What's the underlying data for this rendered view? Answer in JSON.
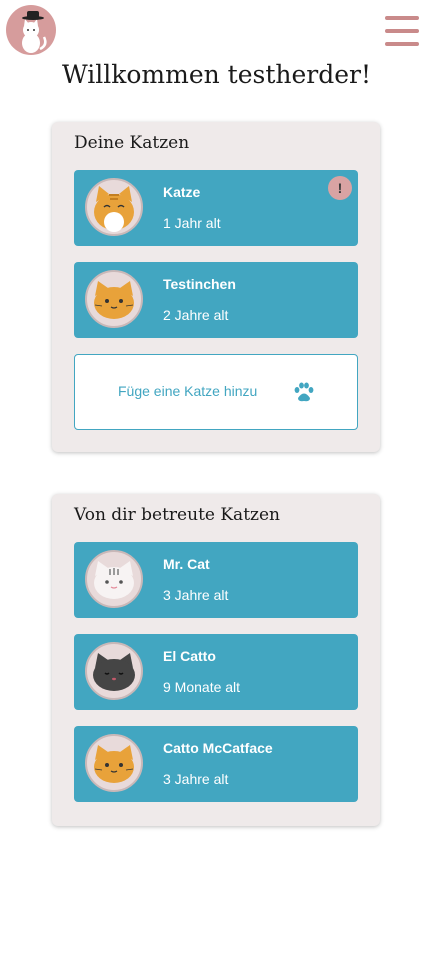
{
  "header": {
    "logo_icon": "cat-logo-icon",
    "menu_icon": "hamburger-menu-icon"
  },
  "welcome": "Willkommen testherder!",
  "own_cats": {
    "title": "Deine Katzen",
    "cats": [
      {
        "name": "Katze",
        "age": "1 Jahr alt",
        "alert": "!",
        "avatar": "orange-cat-white-belly-icon"
      },
      {
        "name": "Testinchen",
        "age": "2 Jahre alt",
        "avatar": "orange-cat-icon"
      }
    ],
    "add_label": "Füge eine Katze hinzu",
    "add_icon": "paw-icon"
  },
  "cared_cats": {
    "title": "Von dir betreute Katzen",
    "cats": [
      {
        "name": "Mr. Cat",
        "age": "3 Jahre alt",
        "avatar": "white-cat-icon"
      },
      {
        "name": "El Catto",
        "age": "9 Monate alt",
        "avatar": "black-cat-icon"
      },
      {
        "name": "Catto McCatface",
        "age": "3 Jahre alt",
        "avatar": "orange-cat-icon"
      }
    ]
  },
  "colors": {
    "accent": "#42a6c1",
    "brand_pink": "#d69c9c",
    "panel_bg": "#efeaea"
  }
}
